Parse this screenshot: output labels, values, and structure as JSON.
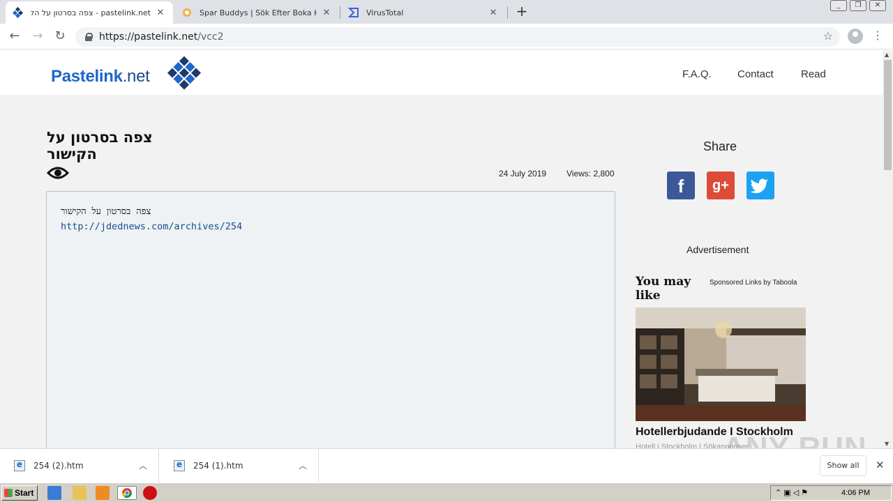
{
  "browser": {
    "tabs": [
      {
        "title": "pastelink.net - צפה בסרטון על הקישור",
        "close": "✕"
      },
      {
        "title": "Spar Buddys | Sök Efter Boka Hotell",
        "close": "✕"
      },
      {
        "title": "VirusTotal",
        "close": "✕"
      }
    ],
    "new_tab": "+",
    "url_host": "https://pastelink.net",
    "url_path": "/vcc2"
  },
  "site": {
    "logo_main": "Pastelink",
    "logo_suffix": ".net",
    "nav": [
      "F.A.Q.",
      "Contact",
      "Read"
    ],
    "colors": {
      "brand": "#1e66c9",
      "brand_dark": "#1e3a6b",
      "facebook": "#3b5998",
      "googleplus": "#dd4b39",
      "twitter": "#1da1f2"
    }
  },
  "post": {
    "title": "צפה בסרטון על הקישור",
    "date": "24 July 2019",
    "views": "Views: 2,800",
    "content_line1": "צפה בסרטון על הקישור",
    "content_link": "http://jdednews.com/archives/254"
  },
  "sidebar": {
    "share_title": "Share",
    "share_buttons": [
      {
        "label": "f",
        "icon": "facebook-icon"
      },
      {
        "label": "g+",
        "icon": "googleplus-icon"
      },
      {
        "label": "",
        "icon": "twitter-icon"
      }
    ],
    "ad_label": "Advertisement",
    "you_may_like": "You may like",
    "sponsored": "Sponsored Links by Taboola",
    "ad_headline": "Hotellerbjudande I Stockholm",
    "ad_sub": "Hotell i Stockholm | Sökannonser"
  },
  "watermark": "ANY RUN",
  "downloads": {
    "items": [
      {
        "name": "254 (2).htm"
      },
      {
        "name": "254 (1).htm"
      }
    ],
    "show_all": "Show all"
  },
  "taskbar": {
    "start": "Start",
    "clock": "4:06 PM"
  }
}
